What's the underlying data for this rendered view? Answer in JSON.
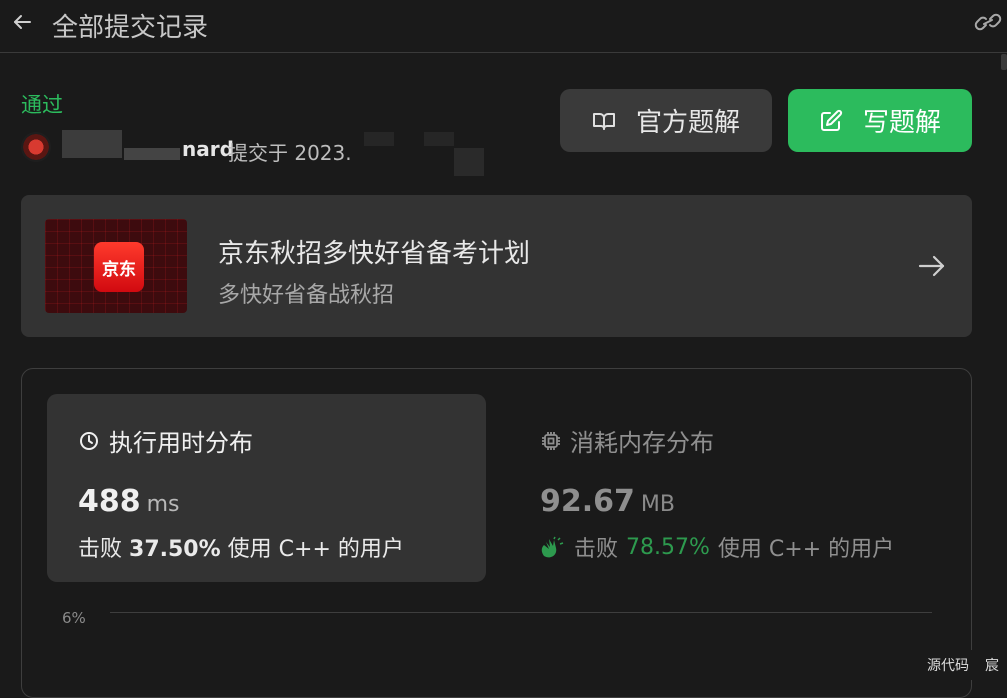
{
  "header": {
    "back_icon": "arrow-left-icon",
    "title": "全部提交记录",
    "link_icon": "link-icon"
  },
  "submission": {
    "status": "通过",
    "username_visible": "nard",
    "submitted_text": "提交于 2023.",
    "status_color": "#2cbb5d"
  },
  "actions": {
    "official_solution": "官方题解",
    "official_icon": "book-open-icon",
    "write_solution": "写题解",
    "write_icon": "edit-icon",
    "accent": "#2cbb5d"
  },
  "banner": {
    "logo_text": "京东",
    "title": "京东秋招多快好省备考计划",
    "subtitle": "多快好省备战秋招",
    "arrow_icon": "arrow-right-icon"
  },
  "runtime": {
    "heading": "执行用时分布",
    "icon": "clock-icon",
    "value": "488",
    "unit": "ms",
    "beat_prefix": "击败",
    "beat_percent": "37.50%",
    "beat_suffix": "使用 C++ 的用户"
  },
  "memory": {
    "heading": "消耗内存分布",
    "icon": "chip-icon",
    "value": "92.67",
    "unit": "MB",
    "beat_icon": "clap-hands-icon",
    "beat_prefix": "击败",
    "beat_percent": "78.57%",
    "beat_suffix": "使用 C++ 的用户"
  },
  "distribution_chart": {
    "y_tick": "6%"
  },
  "corner": {
    "label1": "源代码",
    "label2": "宸"
  }
}
